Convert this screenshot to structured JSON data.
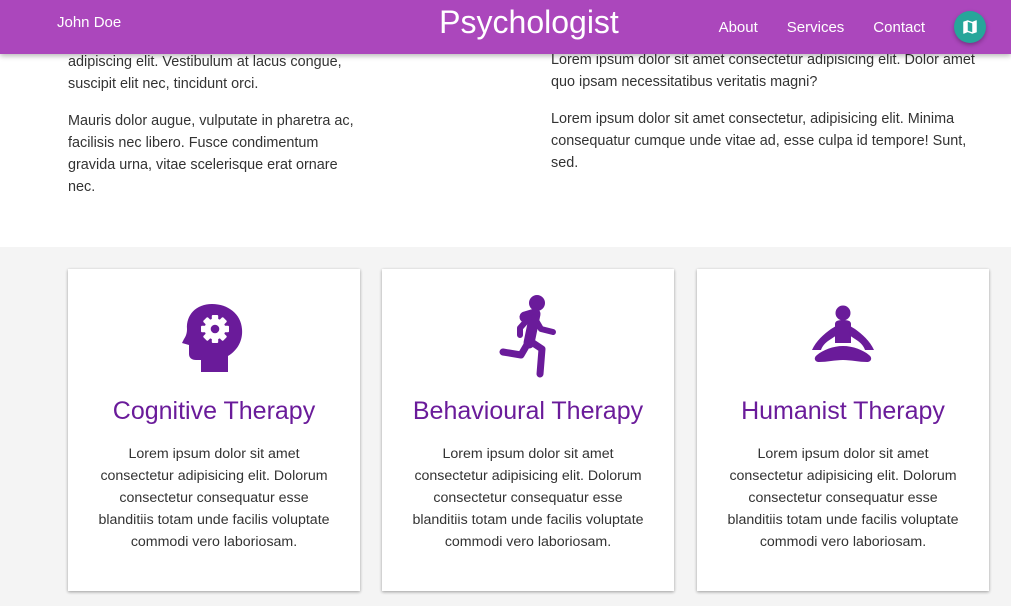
{
  "navbar": {
    "user_name": "John Doe",
    "brand": "Psychologist",
    "links": [
      "About",
      "Services",
      "Contact"
    ],
    "map_icon": "map-icon",
    "bg_color": "#ab47bc",
    "map_button_color": "#26a69a"
  },
  "intro": {
    "left_paragraphs": [
      "adipiscing elit. Vestibulum at lacus congue, suscipit elit nec, tincidunt orci.",
      "Mauris dolor augue, vulputate in pharetra ac, facilisis nec libero. Fusce condimentum gravida urna, vitae scelerisque erat ornare nec."
    ],
    "right_paragraphs": [
      "Lorem ipsum dolor sit amet consectetur adipisicing elit. Dolor amet quo ipsam necessitatibus veritatis magni?",
      "Lorem ipsum dolor sit amet consectetur, adipisicing elit. Minima consequatur cumque unde vitae ad, esse culpa id tempore! Sunt, sed."
    ]
  },
  "services": {
    "accent_color": "#6a1b9a",
    "cards": [
      {
        "icon": "psychology-head-gear-icon",
        "title": "Cognitive Therapy",
        "text": "Lorem ipsum dolor sit amet consectetur adipisicing elit. Dolorum consectetur consequatur esse blanditiis totam unde facilis voluptate commodi vero laboriosam."
      },
      {
        "icon": "running-person-icon",
        "title": "Behavioural Therapy",
        "text": "Lorem ipsum dolor sit amet consectetur adipisicing elit. Dolorum consectetur consequatur esse blanditiis totam unde facilis voluptate commodi vero laboriosam."
      },
      {
        "icon": "meditation-person-icon",
        "title": "Humanist Therapy",
        "text": "Lorem ipsum dolor sit amet consectetur adipisicing elit. Dolorum consectetur consequatur esse blanditiis totam unde facilis voluptate commodi vero laboriosam."
      }
    ]
  }
}
